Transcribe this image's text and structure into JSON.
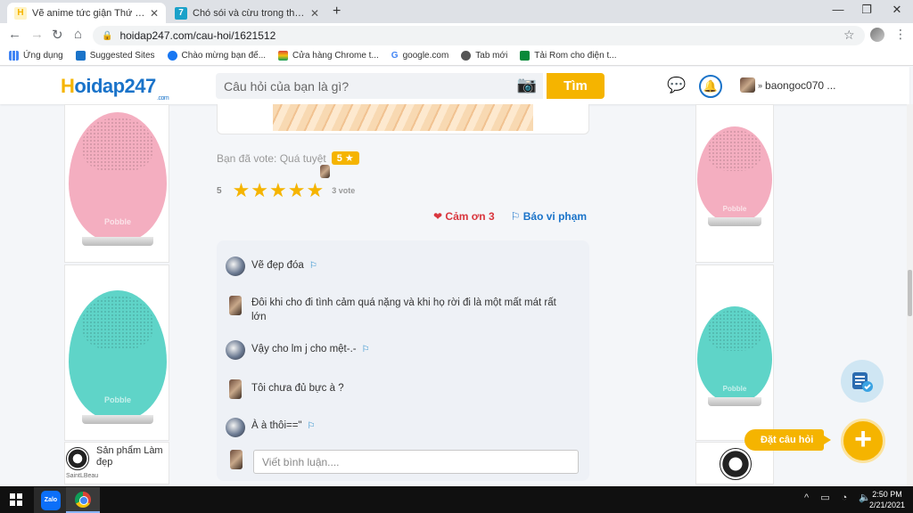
{
  "browser": {
    "tabs": [
      {
        "title": "Vẽ anime tức giận Thứ nhất: nhó",
        "favicon_letter": "H",
        "active": true
      },
      {
        "title": "Chó sói và cừu trong thơ ngụ ngô",
        "favicon_letter": "7",
        "active": false
      }
    ],
    "new_tab": "+",
    "window_controls": {
      "minimize": "—",
      "restore": "❐",
      "close": "✕"
    },
    "url": "hoidap247.com/cau-hoi/1621512",
    "bookmarks": [
      {
        "label": "Ứng dụng",
        "color": "#4285f4"
      },
      {
        "label": "Suggested Sites",
        "color": "#1a73c9"
      },
      {
        "label": "Chào mừng bạn đế...",
        "color": "#1877f2"
      },
      {
        "label": "Cửa hàng Chrome t...",
        "color": "#db4437"
      },
      {
        "label": "google.com",
        "color": "#4285f4"
      },
      {
        "label": "Tab mới",
        "color": "#555555"
      },
      {
        "label": "Tải Rom cho điện t...",
        "color": "#0a8a3a"
      }
    ]
  },
  "site": {
    "logo_h": "H",
    "logo_rest": "oidap247",
    "logo_suffix": ".com",
    "search_placeholder": "Câu hỏi của bạn là gì?",
    "search_button": "Tìm",
    "username": "baongoc070 ...",
    "brand_color": "#1a73c9",
    "accent_color": "#f5b400"
  },
  "answer": {
    "voted_text": "Bạn đã vote: Quá tuyệt",
    "voted_value": "5",
    "rating": "5",
    "stars": 5,
    "vote_count": "3 vote",
    "thanks": "Cảm ơn 3",
    "report": "Báo vi phạm"
  },
  "comments": [
    {
      "text": "Vẽ đẹp đóa",
      "flag": true
    },
    {
      "text": "Đôi khi cho đi tình cảm quá nặng và khi họ rời đi là một mất mát rất lớn",
      "flag": false
    },
    {
      "text": "Vậy cho lm j cho mệt-.-",
      "flag": true
    },
    {
      "text": "Tôi chưa đủ bực à ?",
      "flag": false
    },
    {
      "text": "À à thôi==\"",
      "flag": true
    }
  ],
  "comment_placeholder": "Viết bình luận....",
  "ads": {
    "brand": "Pobble",
    "product_label": "Sản phẩm Làm đẹp",
    "seller": "SaintLBeau",
    "pink": "#f4aec0",
    "teal": "#5fd4c8"
  },
  "floating": {
    "ask_label": "Đặt câu hỏi",
    "add_symbol": "+"
  },
  "taskbar": {
    "zalo_label": "Zalo",
    "time": "2:50 PM",
    "date": "2/21/2021",
    "tray": "^ ▭ ◔ 🔈"
  }
}
